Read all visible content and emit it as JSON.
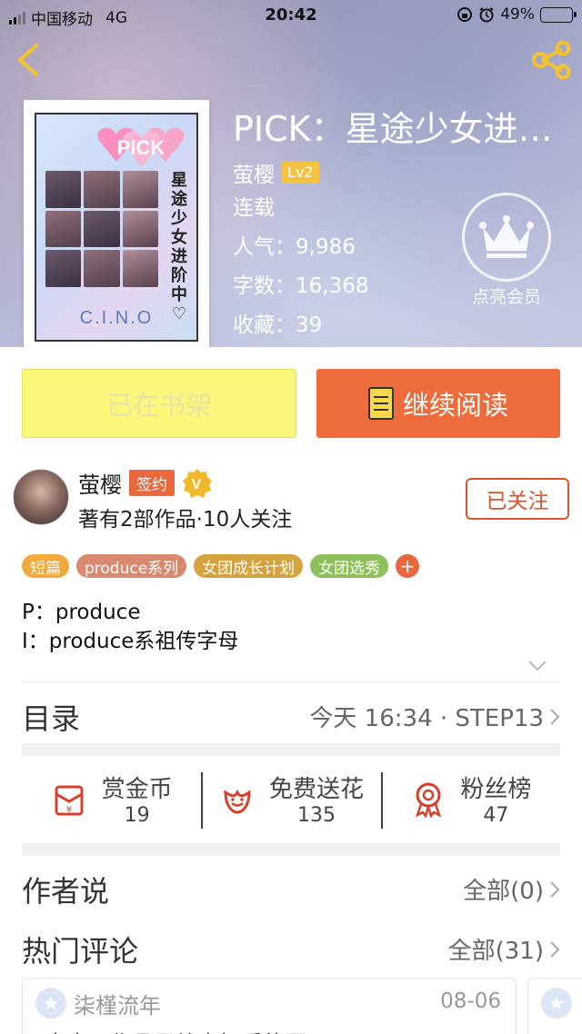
{
  "status_bar": {
    "carrier": "中国移动",
    "network": "4G",
    "time": "20:42",
    "battery_percent": "49%",
    "battery_level": 0.49
  },
  "book": {
    "title": "PICK：星途少女进阶中",
    "author": "萤樱",
    "level": "Lv2",
    "status": "连载",
    "popularity_label": "人气：",
    "popularity": "9,986",
    "words_label": "字数：",
    "words": "16,368",
    "favorites_label": "收藏：",
    "favorites": "39",
    "cover": {
      "badge": "PICK",
      "vertical_title": "星途少女进阶中♡",
      "brand": "C.I.N.O"
    }
  },
  "vip": {
    "label": "点亮会员"
  },
  "actions": {
    "shelf_label": "已在书架",
    "read_label": "继续阅读"
  },
  "author_card": {
    "name": "萤樱",
    "signed_label": "签约",
    "v_badge": "V",
    "stats_text": "著有2部作品·10人关注",
    "follow_label": "已关注"
  },
  "tags": [
    {
      "label": "短篇",
      "color": "#f2a93b"
    },
    {
      "label": "produce系列",
      "color": "#d98a6e"
    },
    {
      "label": "女团成长计划",
      "color": "#d4a23e"
    },
    {
      "label": "女团选秀",
      "color": "#8fbf5a"
    }
  ],
  "tag_add": "+",
  "description": {
    "line1": "P：produce",
    "line2": "I：produce系祖传字母"
  },
  "catalog": {
    "title": "目录",
    "latest": "今天 16:34 · STEP13"
  },
  "stats": [
    {
      "label": "赏金币",
      "value": "19",
      "icon": "red-envelope-icon"
    },
    {
      "label": "免费送花",
      "value": "135",
      "icon": "flower-icon"
    },
    {
      "label": "粉丝榜",
      "value": "47",
      "icon": "medal-icon"
    }
  ],
  "author_says": {
    "title": "作者说",
    "all_label": "全部(0)"
  },
  "hot_comments": {
    "title": "热门评论",
    "all_label": "全部(31)"
  },
  "comment": {
    "user": "柒槿流年",
    "date": "08-06",
    "text": "太太，作品里放点好看的图吧"
  },
  "colors": {
    "accent": "#ee6b3b",
    "shelf_bg": "#fbf77a",
    "follow": "#e0522b"
  }
}
